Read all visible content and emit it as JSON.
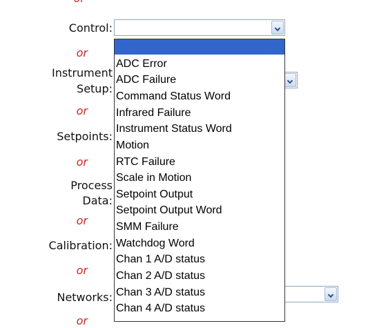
{
  "labels": {
    "control": "Control:",
    "instrument_setup_l1": "Instrument",
    "instrument_setup_l2": "Setup:",
    "setpoints": "Setpoints:",
    "process_data_l1": "Process",
    "process_data_l2": "Data:",
    "calibration": "Calibration:",
    "networks": "Networks:"
  },
  "separator_text": "or",
  "control_select": {
    "value": "",
    "options": [
      "",
      "ADC Error",
      "ADC Failure",
      "Command Status Word",
      "Infrared Failure",
      "Instrument Status Word",
      "Motion",
      "RTC Failure",
      "Scale in Motion",
      "Setpoint Output",
      "Setpoint Output Word",
      "SMM Failure",
      "Watchdog Word",
      "Chan 1 A/D status",
      "Chan 2 A/D status",
      "Chan 3 A/D status",
      "Chan 4 A/D status"
    ]
  },
  "colors": {
    "or_text": "#c62828",
    "highlight": "#3366cc",
    "select_border": "#8fa6c2"
  }
}
